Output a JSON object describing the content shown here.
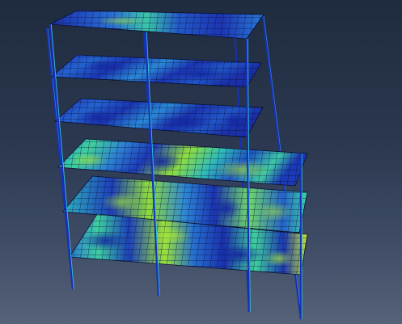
{
  "viewport": {
    "background_top": "#1f2b3e",
    "background_bottom": "#566278"
  },
  "model": {
    "type": "fe-contour-plot",
    "story_count": 6,
    "colors": {
      "column": "#1530b8",
      "column_highlight": "#2f7bd8",
      "mesh_line": "#0a1030",
      "contour_low": "#1c2fb0",
      "contour_mid_low": "#1f78d8",
      "contour_mid": "#1fb8c8",
      "contour_mid_high": "#3fd39a",
      "contour_high": "#9ae23a",
      "contour_peak": "#d7ec2a"
    }
  }
}
